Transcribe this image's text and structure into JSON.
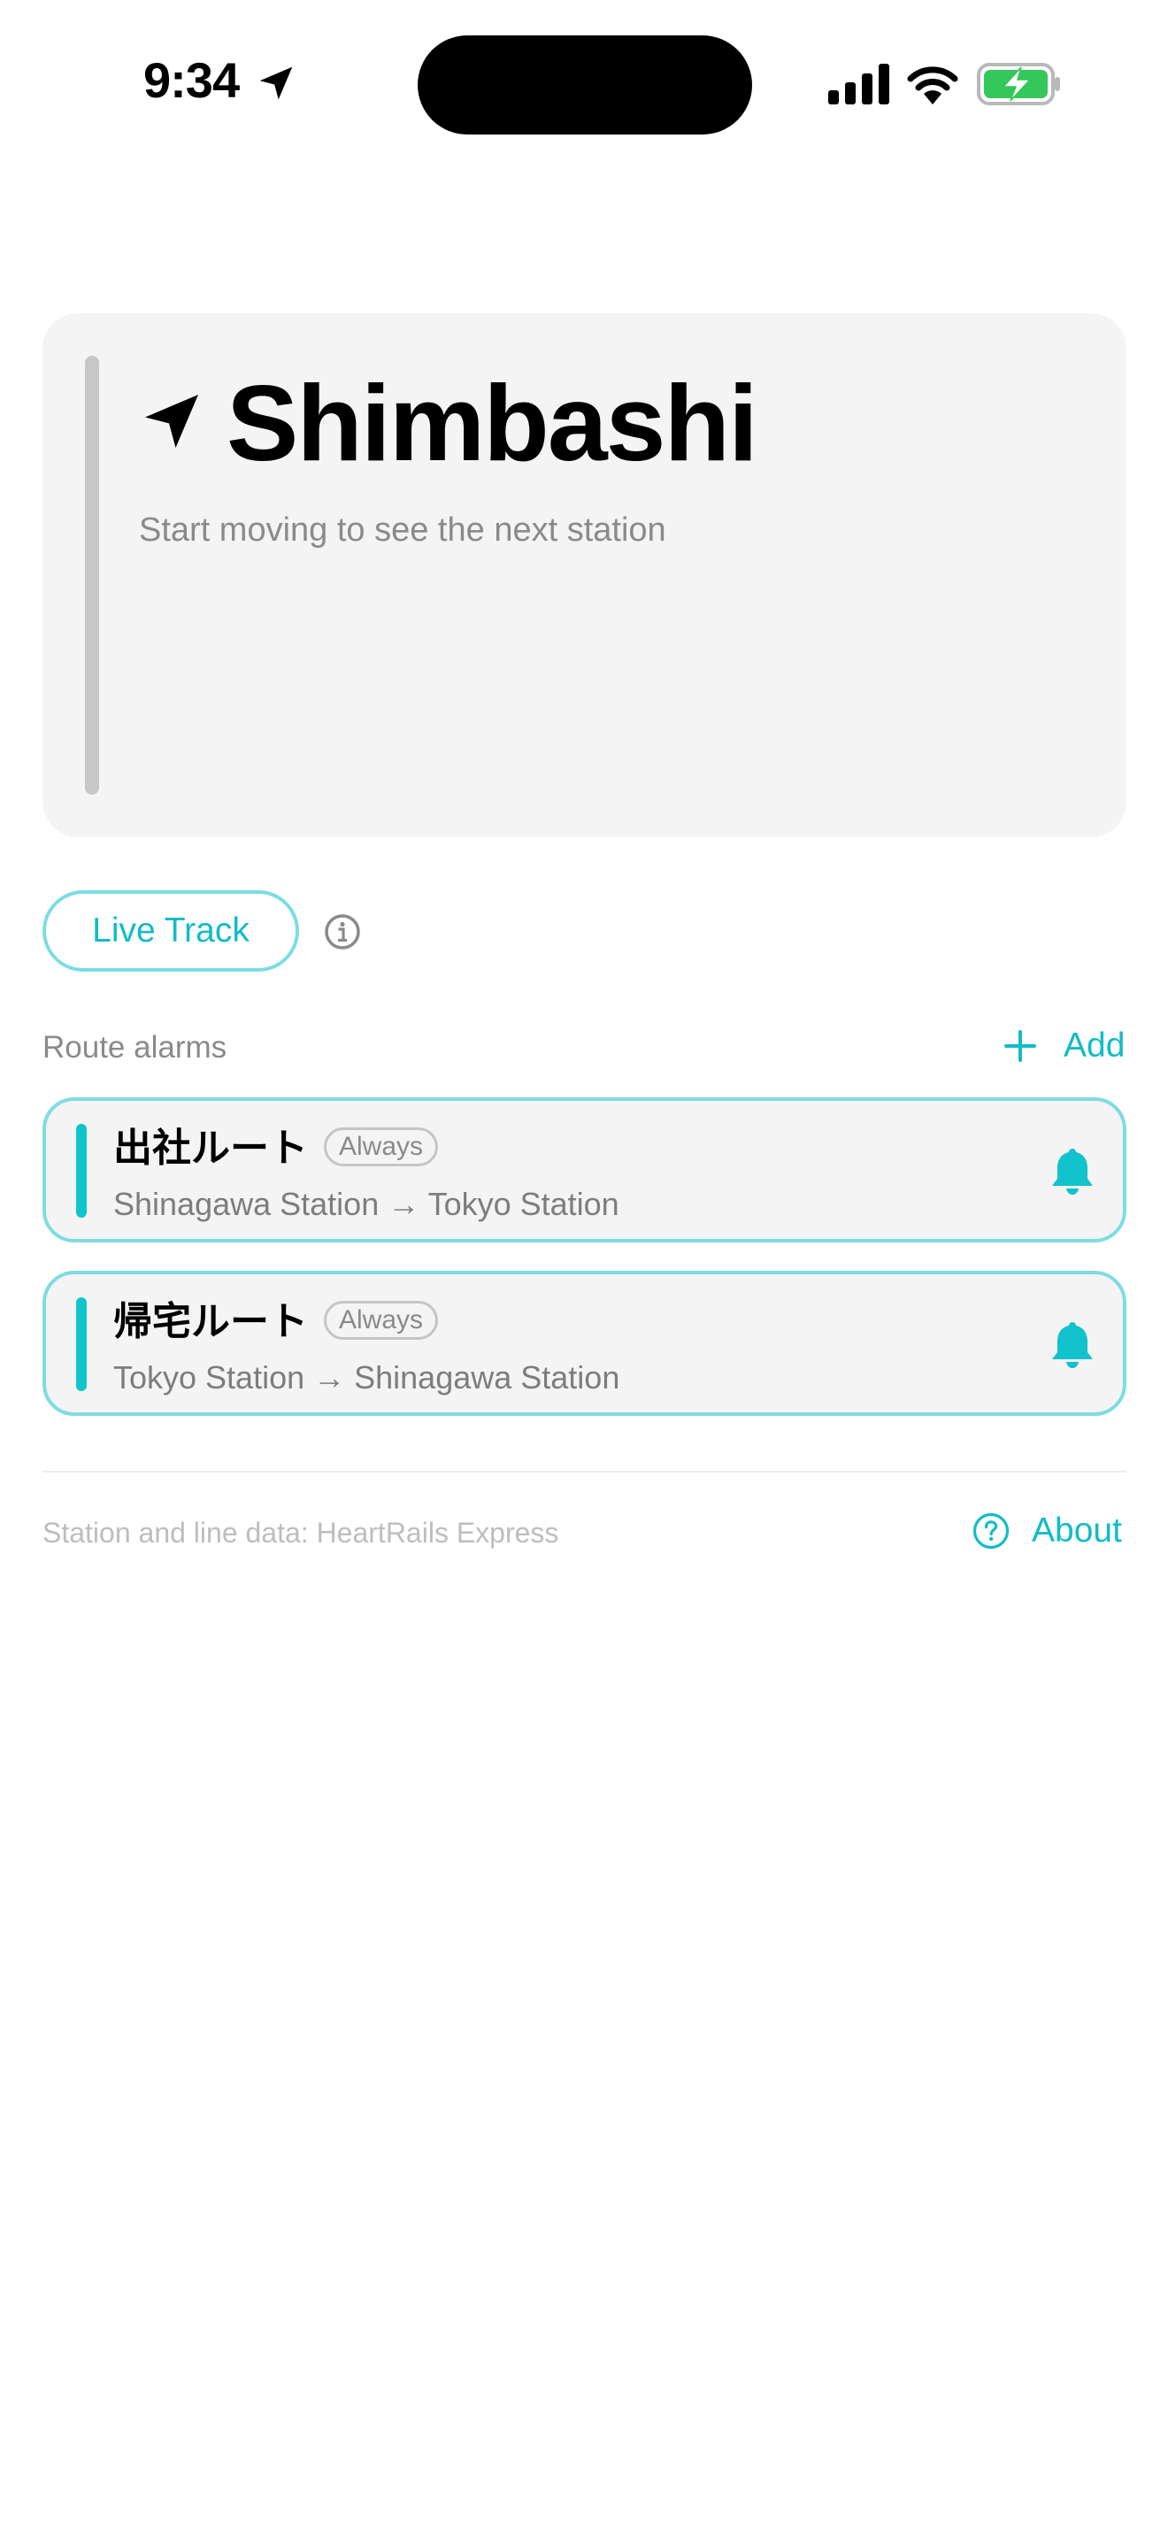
{
  "status_bar": {
    "time": "9:34",
    "battery_color": "#34c759"
  },
  "hero": {
    "station_name": "Shimbashi",
    "subtitle": "Start moving to see the next station",
    "icon": "location-arrow-icon"
  },
  "live_track": {
    "label": "Live Track",
    "info_icon": "info-icon"
  },
  "route_alarms": {
    "title": "Route alarms",
    "add_label": "Add",
    "items": [
      {
        "name": "出社ルート",
        "badge": "Always",
        "route": "Shinagawa Station → Tokyo Station",
        "icon": "bell-icon"
      },
      {
        "name": "帰宅ルート",
        "badge": "Always",
        "route": "Tokyo Station → Shinagawa Station",
        "icon": "bell-icon"
      }
    ]
  },
  "footer": {
    "credit": "Station and line data:  HeartRails Express",
    "about_label": "About",
    "about_icon": "question-circle-icon"
  },
  "colors": {
    "accent": "#12bcc6",
    "card_background": "#f4f4f4",
    "card_border": "#7fdce2"
  }
}
